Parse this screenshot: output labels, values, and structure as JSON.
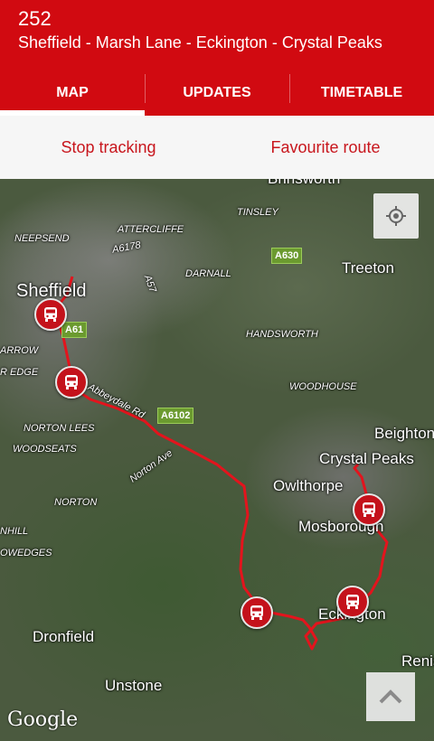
{
  "header": {
    "route_number": "252",
    "route_name": "Sheffield - Marsh Lane - Eckington - Crystal Peaks"
  },
  "tabs": [
    {
      "label": "MAP",
      "active": true
    },
    {
      "label": "UPDATES",
      "active": false
    },
    {
      "label": "TIMETABLE",
      "active": false
    }
  ],
  "actions": {
    "stop_tracking": "Stop tracking",
    "favourite_route": "Favourite route"
  },
  "map": {
    "labels": {
      "brinsworth": "Brinsworth",
      "tinsley": "TINSLEY",
      "attercliffe": "ATTERCLIFFE",
      "neepsend": "NEEPSEND",
      "a6178": "A6178",
      "treeton": "Treeton",
      "darnall": "DARNALL",
      "a57": "A57",
      "sheffield": "Sheffield",
      "handsworth": "HANDSWORTH",
      "arrow": "ARROW",
      "r_edge": "R EDGE",
      "woodhouse": "WOODHOUSE",
      "abbeydale_rd": "Abbeydale Rd",
      "norton_lees": "NORTON LEES",
      "beighton": "Beighton",
      "woodseats": "WOODSEATS",
      "crystal_peaks": "Crystal Peaks",
      "norton_ave": "Norton Ave",
      "owlthorpe": "Owlthorpe",
      "norton": "NORTON",
      "mosborough": "Mosborough",
      "nhill": "NHILL",
      "owedges": "OWEDGES",
      "eckington": "Eckington",
      "dronfield": "Dronfield",
      "renis": "Renis",
      "unstone": "Unstone",
      "google": "Google"
    },
    "roads": {
      "a630": "A630",
      "a61": "A61",
      "a6102": "A6102"
    },
    "icons": {
      "locate": "my-location-icon",
      "scroll_up": "chevron-up-icon",
      "bus": "bus-icon"
    },
    "route_color": "#e3141d",
    "bus_markers": [
      "bus-stop-sheffield",
      "bus-stop-south-sheffield",
      "bus-stop-marsh-lane",
      "bus-stop-eckington",
      "bus-stop-mosborough"
    ]
  },
  "colors": {
    "brand_red": "#d10a11",
    "action_text": "#c8161d"
  }
}
